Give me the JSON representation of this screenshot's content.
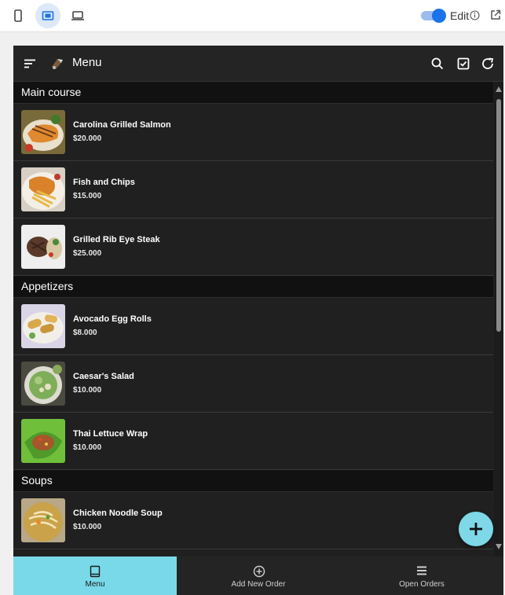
{
  "editor": {
    "edit_label": "Edit"
  },
  "app": {
    "title": "Menu"
  },
  "sections": [
    {
      "title": "Main course",
      "items": [
        {
          "name": "Carolina Grilled Salmon",
          "price": "$20.000"
        },
        {
          "name": "Fish and Chips",
          "price": "$15.000"
        },
        {
          "name": "Grilled Rib Eye Steak",
          "price": "$25.000"
        }
      ]
    },
    {
      "title": "Appetizers",
      "items": [
        {
          "name": "Avocado Egg Rolls",
          "price": "$8.000"
        },
        {
          "name": "Caesar's Salad",
          "price": "$10.000"
        },
        {
          "name": "Thai Lettuce Wrap",
          "price": "$10.000"
        }
      ]
    },
    {
      "title": "Soups",
      "items": [
        {
          "name": "Chicken Noodle Soup",
          "price": "$10.000"
        }
      ]
    }
  ],
  "bottom_nav": {
    "tabs": [
      {
        "label": "Menu",
        "icon": "book-icon",
        "active": true
      },
      {
        "label": "Add New Order",
        "icon": "add-circle-icon",
        "active": false
      },
      {
        "label": "Open Orders",
        "icon": "list-icon",
        "active": false
      }
    ]
  },
  "colors": {
    "accent": "#79d9e9",
    "toggle": "#1a73e8",
    "background": "#202020"
  }
}
